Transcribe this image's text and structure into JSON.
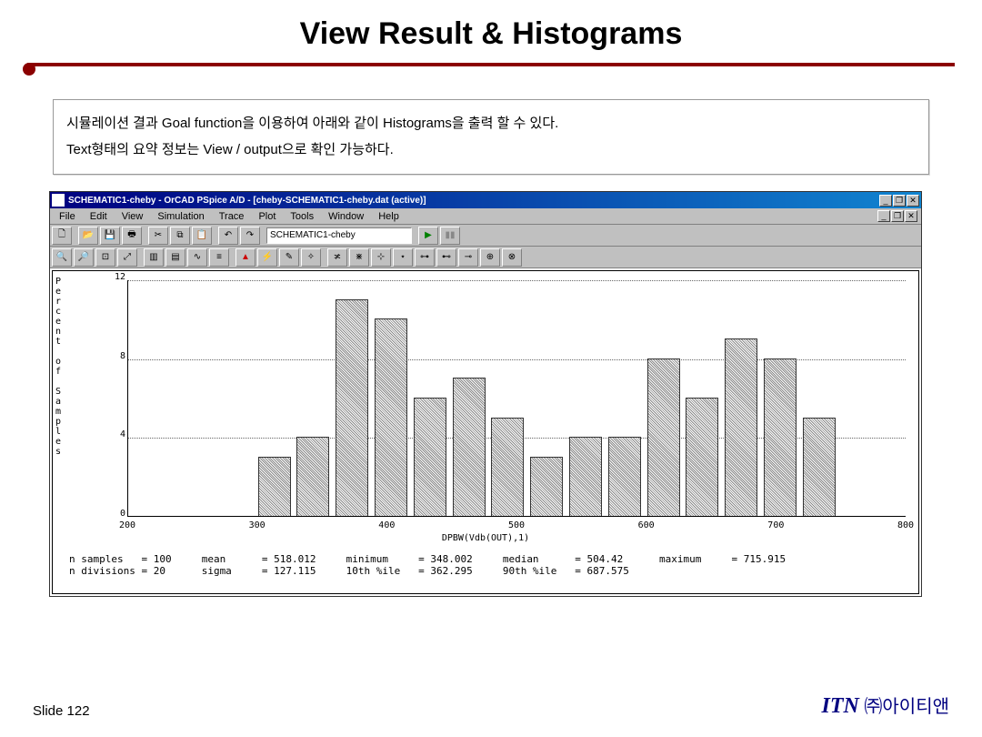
{
  "slide": {
    "title": "View Result & Histograms",
    "info_line1": "시뮬레이션 결과 Goal function을 이용하여 아래와 같이 Histograms을 출력 할 수 있다.",
    "info_line2": "Text형태의 요약 정보는 View / output으로 확인 가능하다.",
    "footer_left": "Slide 122",
    "footer_right_brand": "ITN",
    "footer_right_company": "㈜아이티앤"
  },
  "app": {
    "titlebar_text": "SCHEMATIC1-cheby - OrCAD PSpice A/D - [cheby-SCHEMATIC1-cheby.dat (active)]",
    "menus": [
      "File",
      "Edit",
      "View",
      "Simulation",
      "Trace",
      "Plot",
      "Tools",
      "Window",
      "Help"
    ],
    "combo_value": "SCHEMATIC1-cheby"
  },
  "chart_data": {
    "type": "bar",
    "xlabel": "DPBW(Vdb(OUT),1)",
    "ylabel_vert": "Percent of Samples",
    "x_ticks": [
      200,
      300,
      400,
      500,
      600,
      700,
      800
    ],
    "y_ticks": [
      0,
      4,
      8,
      12
    ],
    "categories": [
      300,
      330,
      360,
      390,
      420,
      450,
      480,
      510,
      540,
      570,
      600,
      630,
      660,
      690,
      720
    ],
    "values": [
      3,
      4,
      11,
      10,
      6,
      7,
      5,
      3,
      4,
      4,
      8,
      6,
      9,
      8,
      5
    ],
    "ylim": [
      0,
      12
    ]
  },
  "stats": {
    "n_samples_label": "n samples   = ",
    "n_samples": "100",
    "n_div_label": "n divisions = ",
    "n_div": "20",
    "mean_label": "mean",
    "mean": "= 518.012",
    "sigma_label": "sigma",
    "sigma": "= 127.115",
    "min_label": "minimum",
    "min": "= 348.002",
    "p10_label": "10th %ile",
    "p10": "= 362.295",
    "median_label": "median",
    "median": "= 504.42",
    "p90_label": "90th %ile",
    "p90": "= 687.575",
    "max_label": "maximum",
    "max": "= 715.915"
  }
}
